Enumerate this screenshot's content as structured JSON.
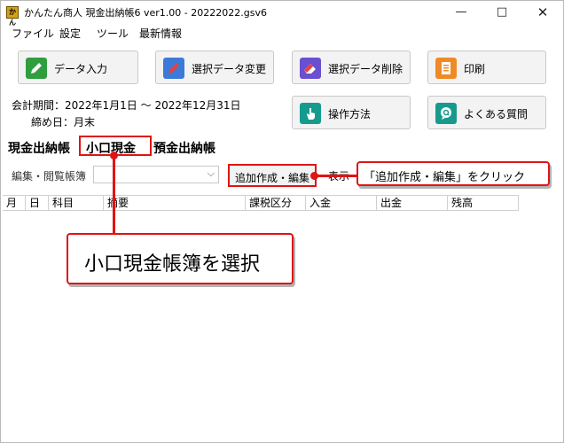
{
  "window": {
    "title": "かんたん商人 現金出納帳6 ver1.00 - 20222022.gsv6",
    "icon_text": "かん",
    "minimize": "—",
    "maximize": "□",
    "close": "✕"
  },
  "menu": {
    "items": [
      "ファイル",
      "設定",
      "ツール",
      "最新情報"
    ]
  },
  "toolbar": {
    "data_entry": "データ入力",
    "change_selected": "選択データ変更",
    "delete_selected": "選択データ削除",
    "print": "印刷",
    "how_to": "操作方法",
    "faq": "よくある質問"
  },
  "info": {
    "period": "会計期間：2022年1月1日 〜 2022年12月31日",
    "closing": "締め日：月末"
  },
  "book_tabs": [
    "現金出納帳",
    "小口現金",
    "預金出納帳"
  ],
  "ledger": {
    "label": "編集・閲覧帳簿",
    "selected": "",
    "arrow": "⌵",
    "add_edit_button": "追加作成・編集",
    "display_label": "表示"
  },
  "table": {
    "columns": [
      "月",
      "日",
      "科目",
      "摘要",
      "課税区分",
      "入金",
      "出金",
      "残高"
    ]
  },
  "annotations": {
    "select_petty_cash": "小口現金帳簿を選択",
    "click_add_edit": "「追加作成・編集」をクリック"
  },
  "colors": {
    "highlight": "#e01414"
  }
}
